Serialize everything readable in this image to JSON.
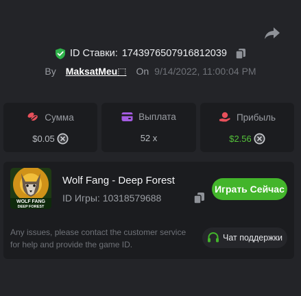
{
  "header": {
    "bet_id_label": "ID Ставки:",
    "bet_id_value": "1743976507916812039",
    "by_label": "By",
    "username": "MaksatMeu⬚",
    "on_label": "On",
    "datetime": "9/14/2022, 11:00:04 PM"
  },
  "stats": {
    "amount_label": "Сумма",
    "amount_value": "$0.05",
    "payout_label": "Выплата",
    "payout_value": "52 x",
    "profit_label": "Прибыль",
    "profit_value": "$2.56"
  },
  "game": {
    "title": "Wolf Fang - Deep Forest",
    "id_label": "ID Игры:",
    "id_value": "10318579688",
    "thumb_line1": "WOLF FANG",
    "thumb_line2": "DEEP FOREST",
    "play_label": "Играть Сейчас"
  },
  "support": {
    "help_text": "Any issues, please contact the customer service for help and provide the game ID.",
    "button_label": "Чат поддержки"
  },
  "colors": {
    "accent_green": "#43b52b",
    "profit_green": "#54c23a",
    "amount_icon": "#e8505b",
    "payout_icon": "#a35be0",
    "profit_icon": "#e8505b",
    "background": "#232428",
    "card": "#1b1c1f"
  },
  "icons": {
    "share": "share-arrow-icon",
    "shield": "shield-check-icon",
    "copy": "copy-icon",
    "coin": "coin-icon",
    "amount": "stack-coins-icon",
    "payout": "wallet-icon",
    "profit": "hand-coin-icon",
    "support": "headset-icon"
  }
}
